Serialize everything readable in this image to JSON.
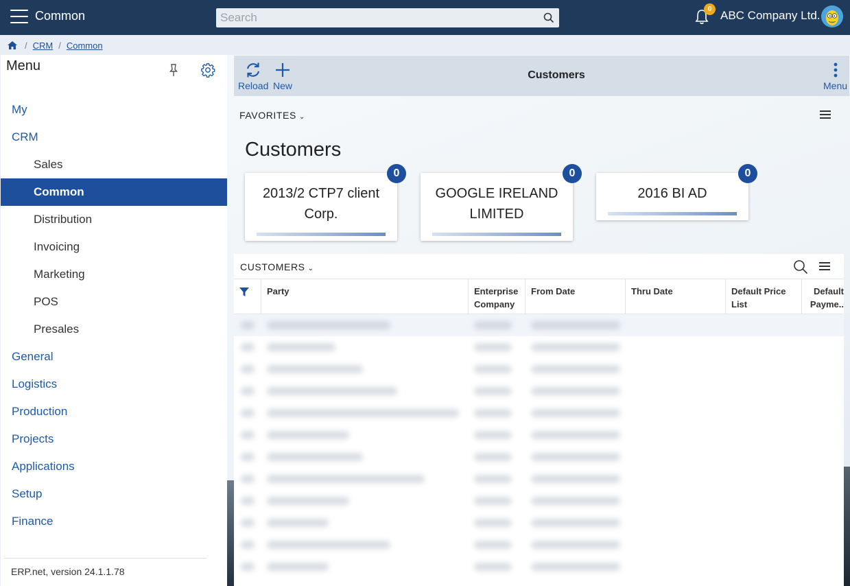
{
  "topbar": {
    "title": "Common",
    "search_placeholder": "Search",
    "notification_count": "0",
    "company": "ABC Company Ltd."
  },
  "breadcrumb": {
    "items": [
      "CRM",
      "Common"
    ]
  },
  "sidebar": {
    "title": "Menu",
    "items": [
      {
        "label": "My",
        "level": 1
      },
      {
        "label": "CRM",
        "level": 1
      },
      {
        "label": "Sales",
        "level": 2
      },
      {
        "label": "Common",
        "level": 2,
        "active": true
      },
      {
        "label": "Distribution",
        "level": 2
      },
      {
        "label": "Invoicing",
        "level": 2
      },
      {
        "label": "Marketing",
        "level": 2
      },
      {
        "label": "POS",
        "level": 2
      },
      {
        "label": "Presales",
        "level": 2
      },
      {
        "label": "General",
        "level": 1
      },
      {
        "label": "Logistics",
        "level": 1
      },
      {
        "label": "Production",
        "level": 1
      },
      {
        "label": "Projects",
        "level": 1
      },
      {
        "label": "Applications",
        "level": 1
      },
      {
        "label": "Setup",
        "level": 1
      },
      {
        "label": "Finance",
        "level": 1
      }
    ],
    "version": "ERP.net, version 24.1.1.78"
  },
  "toolbar": {
    "reload_label": "Reload",
    "new_label": "New",
    "title": "Customers",
    "menu_label": "Menu"
  },
  "favorites": {
    "label": "FAVORITES"
  },
  "page_heading": "Customers",
  "cards": [
    {
      "name": "2013/2 CTP7 client Corp.",
      "badge": "0"
    },
    {
      "name": "GOOGLE IRELAND LIMITED",
      "badge": "0"
    },
    {
      "name": "2016 BI AD",
      "badge": "0"
    }
  ],
  "grid": {
    "title": "CUSTOMERS",
    "columns": [
      "Party",
      "Enterprise Company",
      "From Date",
      "Thru Date",
      "Default Price List",
      "Default Payme.."
    ]
  },
  "colors": {
    "topbar": "#1f3a5b",
    "accent": "#1d4f9c",
    "link": "#1d5aa8",
    "badge_orange": "#f0a81c"
  }
}
